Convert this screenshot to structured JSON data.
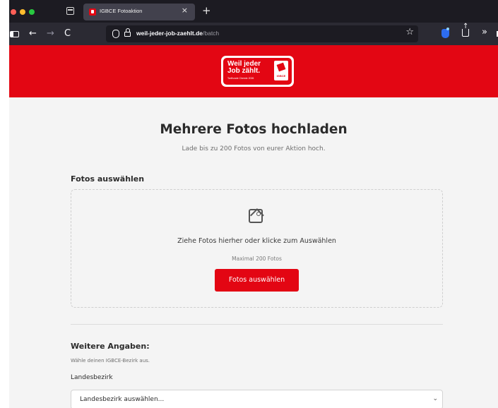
{
  "browser": {
    "tab_title": "IGBCE Fotoaktion",
    "tab_close": "×",
    "new_tab": "+",
    "url_domain": "weil-jeder-job-zaehlt.de",
    "url_path": "/batch",
    "star_glyph": "☆",
    "overflow_glyph": "»",
    "back_glyph": "←",
    "forward_glyph": "→",
    "reload_glyph": "C"
  },
  "logo": {
    "line1": "Weil jeder",
    "line2": "Job zählt.",
    "tagline": "Tarifrunde Chemie 2026",
    "brand": "IGBCE"
  },
  "page": {
    "title": "Mehrere Fotos hochladen",
    "subtitle": "Lade bis zu 200 Fotos von eurer Aktion hoch."
  },
  "upload": {
    "heading": "Fotos auswählen",
    "drop_text": "Ziehe Fotos hierher oder klicke zum Auswählen",
    "limit_text": "Maximal 200 Fotos",
    "button_label": "Fotos auswählen"
  },
  "details": {
    "heading": "Weitere Angaben:",
    "helper": "Wähle deinen IGBCE-Bezirk aus.",
    "field_label": "Landesbezirk",
    "select_value": "Landesbezirk auswählen...",
    "chevron": "⌄"
  },
  "colors": {
    "brand_red": "#e30613",
    "browser_dark": "#1c1b22",
    "toolbar": "#2b2a33",
    "page_bg": "#f4f4f4"
  }
}
